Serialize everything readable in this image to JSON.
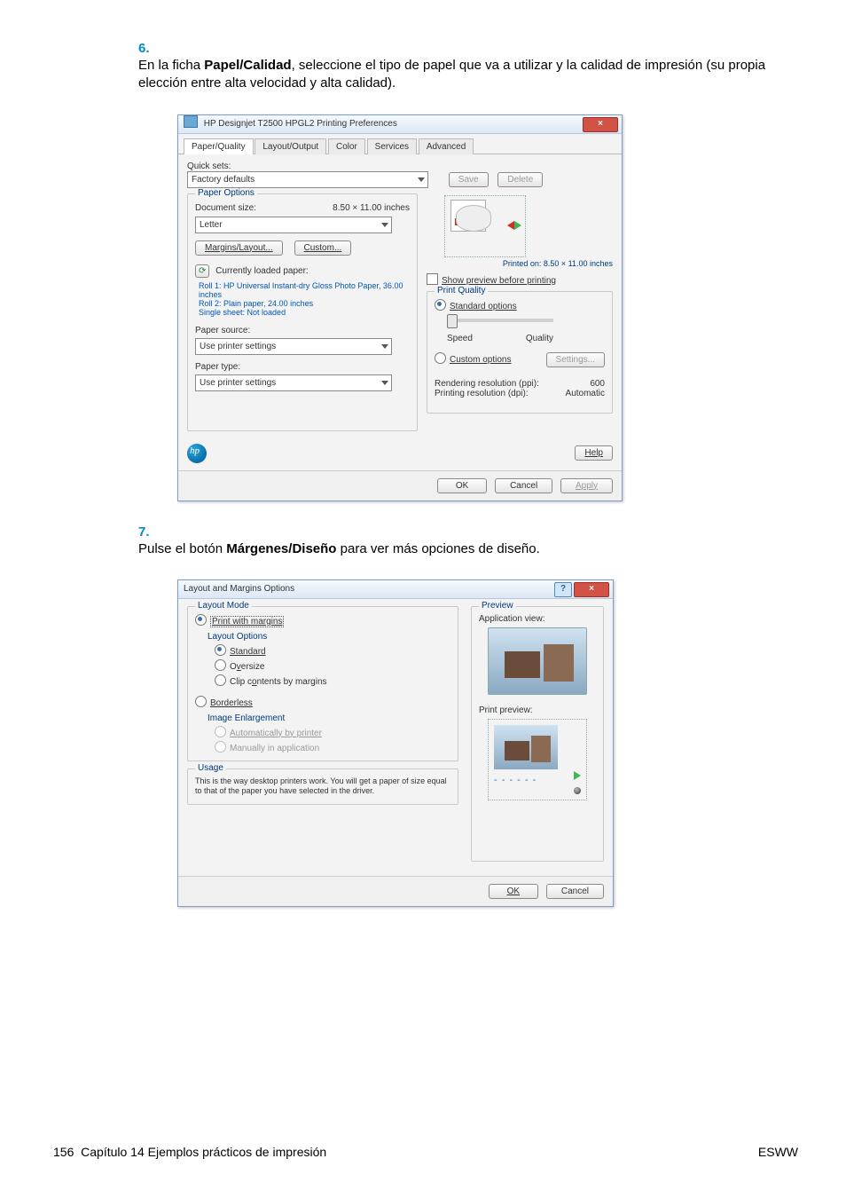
{
  "step6": {
    "num": "6.",
    "text_a": "En la ficha ",
    "text_b": "Papel/Calidad",
    "text_c": ", seleccione el tipo de papel que va a utilizar y la calidad de impresión (su propia elección entre alta velocidad y alta calidad)."
  },
  "step7": {
    "num": "7.",
    "text_a": "Pulse el botón ",
    "text_b": "Márgenes/Diseño",
    "text_c": " para ver más opciones de diseño."
  },
  "dialog1": {
    "title": "HP Designjet T2500 HPGL2 Printing Preferences",
    "tabs": [
      "Paper/Quality",
      "Layout/Output",
      "Color",
      "Services",
      "Advanced"
    ],
    "quicksets_lbl": "Quick sets:",
    "quicksets_value": "Factory defaults",
    "save": "Save",
    "delete": "Delete",
    "paperoptions": "Paper Options",
    "docsize_lbl": "Document size:",
    "docsize_val": "8.50 × 11.00 inches",
    "docsize_sel": "Letter",
    "margins_btn": "Margins/Layout...",
    "custom_btn": "Custom...",
    "loaded_icon": "refresh-icon",
    "loaded_lbl": "Currently loaded paper:",
    "rolls": "Roll 1: HP Universal Instant-dry Gloss Photo Paper, 36.00 inches\nRoll 2: Plain paper, 24.00 inches\nSingle sheet: Not loaded",
    "papersource_lbl": "Paper source:",
    "papersource_val": "Use printer settings",
    "papertype_lbl": "Paper type:",
    "papertype_val": "Use printer settings",
    "printedon": "Printed on: 8.50 × 11.00 inches",
    "showpreview": "Show preview before printing",
    "printquality": "Print Quality",
    "stdopt": "Standard options",
    "speed": "Speed",
    "quality": "Quality",
    "customopt": "Custom options",
    "settings": "Settings...",
    "rr_lbl": "Rendering resolution (ppi):",
    "rr_val": "600",
    "pr_lbl": "Printing resolution (dpi):",
    "pr_val": "Automatic",
    "help": "Help",
    "ok": "OK",
    "cancel": "Cancel",
    "apply": "Apply"
  },
  "dialog2": {
    "title": "Layout and Margins Options",
    "layoutmode": "Layout Mode",
    "printwithmargins": "Print with margins",
    "layoutoptions": "Layout Options",
    "standard": "Standard",
    "oversize": "Oversize",
    "clip": "Clip contents by margins",
    "borderless": "Borderless",
    "imgenl": "Image Enlargement",
    "auto": "Automatically by printer",
    "manual": "Manually in application",
    "usage": "Usage",
    "usagetext": "This is the way desktop printers work. You will get a paper of size equal to that of the paper you have selected in the driver.",
    "preview": "Preview",
    "appview": "Application view:",
    "printpreview": "Print preview:",
    "ok": "OK",
    "cancel": "Cancel"
  },
  "footer": {
    "left_a": "156",
    "left_b": "Capítulo 14   Ejemplos prácticos de impresión",
    "right": "ESWW"
  }
}
